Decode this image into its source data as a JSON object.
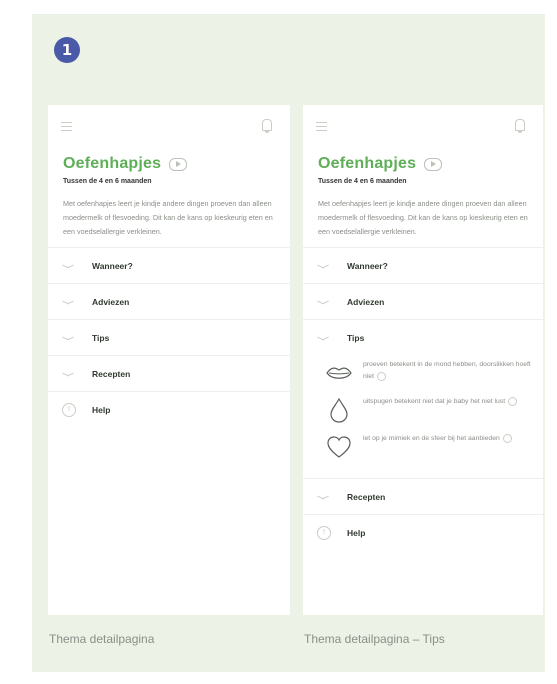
{
  "step_number": "1",
  "screens": [
    {
      "title": "Oefenhapjes",
      "subtitle": "Tussen de 4 en 6 maanden",
      "intro": "Met oefenhapjes leert je kindje andere dingen proeven dan alleen moedermelk of flesvoeding. Dit kan de kans op kieskeurig eten en een voedselallergie verkleinen.",
      "sections": [
        "Wanneer?",
        "Adviezen",
        "Tips",
        "Recepten"
      ],
      "help": "Help",
      "caption": "Thema detailpagina"
    },
    {
      "title": "Oefenhapjes",
      "subtitle": "Tussen de 4 en 6 maanden",
      "intro": "Met oefenhapjes leert je kindje andere dingen proeven dan alleen moedermelk of flesvoeding. Dit kan de kans op kieskeurig eten en een voedselallergie verkleinen.",
      "sections_before": [
        "Wanneer?",
        "Adviezen",
        "Tips"
      ],
      "tips": [
        {
          "icon": "lips-icon",
          "text": "proeven betekent in de mond hebben, doorslikken hoeft niet"
        },
        {
          "icon": "drop-icon",
          "text": "uitspugen betekent niet dat je baby het niet lust"
        },
        {
          "icon": "heart-icon",
          "text": "let op je mimiek en de sfeer bij het aanbieden"
        }
      ],
      "sections_after": [
        "Recepten"
      ],
      "help": "Help",
      "caption": "Thema detailpagina – Tips"
    }
  ],
  "colors": {
    "panel": "#ecf2e6",
    "accent": "#5fae58",
    "badge": "#4a59a8"
  }
}
